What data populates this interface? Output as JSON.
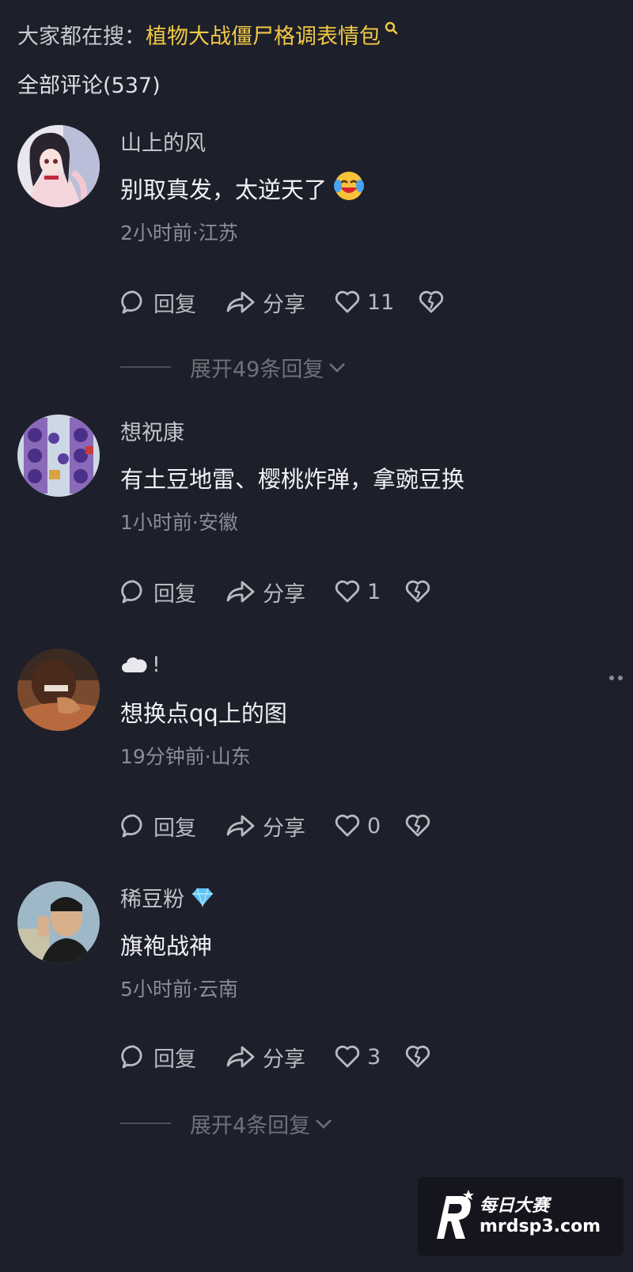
{
  "search": {
    "prefix": "大家都在搜：",
    "query": "植物大战僵尸格调表情包"
  },
  "comments_header": {
    "label": "全部评论(537)"
  },
  "actions": {
    "reply": "回复",
    "share": "分享"
  },
  "comments": [
    {
      "username": "山上的风",
      "text": "别取真发，太逆天了",
      "meta": "2小时前·江苏",
      "likes": "11",
      "expand": "展开49条回复"
    },
    {
      "username": "想祝康",
      "text": "有土豆地雷、樱桃炸弹，拿豌豆换",
      "meta": "1小时前·安徽",
      "likes": "1"
    },
    {
      "username": "!",
      "text": "想换点qq上的图",
      "meta": "19分钟前·山东",
      "likes": "0"
    },
    {
      "username": "稀豆粉",
      "text": "旗袍战神",
      "meta": "5小时前·云南",
      "likes": "3",
      "expand": "展开4条回复"
    }
  ],
  "watermark": {
    "title": "每日大赛",
    "url": "mrdsp3.com"
  },
  "colors": {
    "background": "#1d1f2a",
    "search_highlight": "#f2c945",
    "muted": "#8b8c96"
  }
}
